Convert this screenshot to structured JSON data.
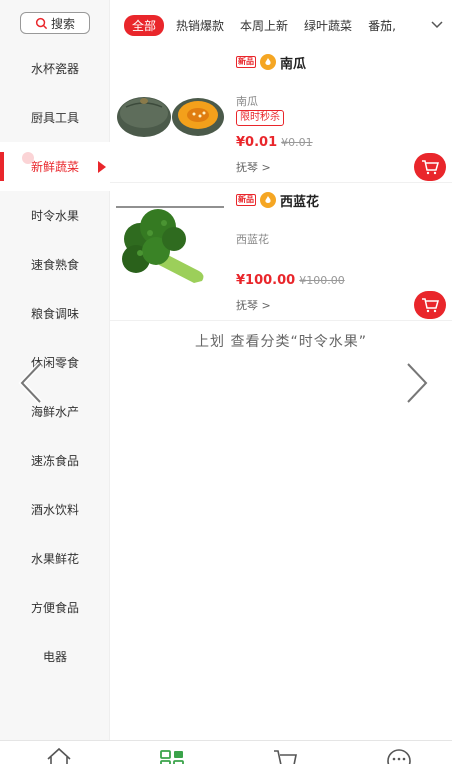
{
  "search": {
    "label": "搜索"
  },
  "sidebar": {
    "items": [
      {
        "label": "水杯瓷器",
        "active": false
      },
      {
        "label": "厨具工具",
        "active": false
      },
      {
        "label": "新鲜蔬菜",
        "active": true
      },
      {
        "label": "时令水果",
        "active": false
      },
      {
        "label": "速食熟食",
        "active": false
      },
      {
        "label": "粮食调味",
        "active": false
      },
      {
        "label": "休闲零食",
        "active": false
      },
      {
        "label": "海鲜水产",
        "active": false
      },
      {
        "label": "速冻食品",
        "active": false
      },
      {
        "label": "酒水饮料",
        "active": false
      },
      {
        "label": "水果鲜花",
        "active": false
      },
      {
        "label": "方便食品",
        "active": false
      },
      {
        "label": "电器",
        "active": false
      }
    ]
  },
  "tabs": {
    "items": [
      "全部",
      "热销爆款",
      "本周上新",
      "绿叶蔬菜",
      "番茄,"
    ],
    "active": "全部"
  },
  "products": [
    {
      "badge": "新品",
      "name": "南瓜",
      "subtitle": "南瓜",
      "tag": "限时秒杀",
      "price": "¥0.01",
      "old_price": "¥0.01",
      "seller": "抚琴 >"
    },
    {
      "badge": "新品",
      "name": "西蓝花",
      "subtitle": "西蓝花",
      "price": "¥100.00",
      "old_price": "¥100.00",
      "seller": "抚琴 >"
    }
  ],
  "swipe_hint": "上划 查看分类“时令水果”",
  "colors": {
    "accent": "#e9262b",
    "fire": "#f5a623"
  },
  "icons": [
    "search-icon",
    "chevron-down-icon",
    "cart-icon",
    "flame-icon",
    "chevron-left-icon",
    "chevron-right-icon",
    "home-icon",
    "category-icon",
    "shopping-cart-icon",
    "message-icon"
  ]
}
